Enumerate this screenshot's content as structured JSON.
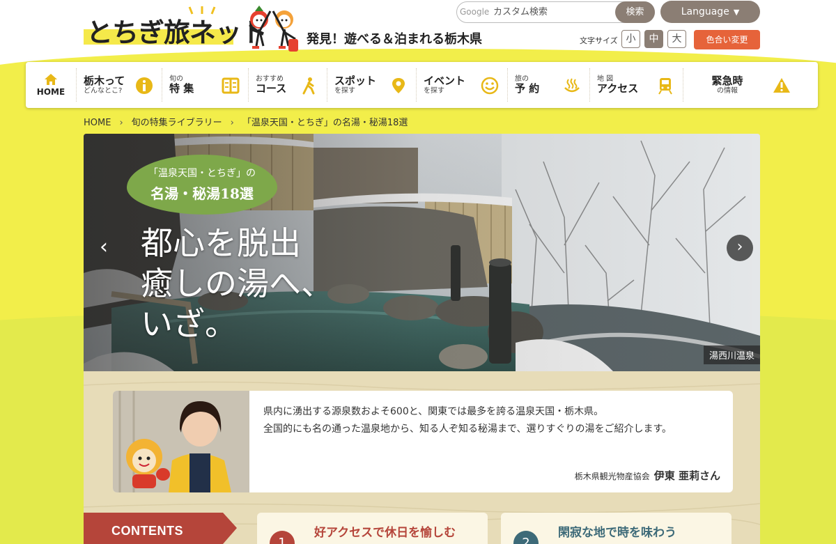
{
  "header": {
    "logo_text": "とちぎ旅ネット",
    "tagline": "発見！遊べる＆泊まれる栃木県",
    "search": {
      "brand": "Google",
      "placeholder": "カスタム検索",
      "button_label": "検索"
    },
    "language_label": "Language",
    "font_size": {
      "label": "文字サイズ",
      "small": "小",
      "medium": "中",
      "large": "大"
    },
    "color_button_label": "色合い変更"
  },
  "nav": {
    "home": "HOME",
    "items": [
      {
        "big": "栃木って",
        "small": "どんなとこ?",
        "icon": "info-icon"
      },
      {
        "small": "旬の",
        "big": "特 集",
        "icon": "book-icon"
      },
      {
        "small": "おすすめ",
        "big": "コース",
        "icon": "walking-icon"
      },
      {
        "big": "スポット",
        "small": "を探す",
        "icon": "pin-icon"
      },
      {
        "big": "イベント",
        "small": "を探す",
        "icon": "smile-icon"
      },
      {
        "small": "旅の",
        "big": "予 約",
        "icon": "onsen-icon"
      },
      {
        "small": "地 図",
        "big": "アクセス",
        "icon": "train-icon"
      },
      {
        "big": "緊急時",
        "small": "の情報",
        "icon": "warning-icon"
      }
    ]
  },
  "breadcrumb": {
    "home": "HOME",
    "library": "旬の特集ライブラリー",
    "current": "「温泉天国・とちぎ」の名湯・秘湯18選"
  },
  "hero": {
    "badge_line1": "「温泉天国・とちぎ」の",
    "badge_line2": "名湯・秘湯18選",
    "copy_line1": "都心を脱出",
    "copy_line2": "癒しの湯へ、",
    "copy_line3": "いざ。",
    "caption": "湯西川温泉",
    "prev": "‹",
    "next": "›"
  },
  "intro": {
    "line1": "県内に湧出する源泉数およそ600と、関東では最多を誇る温泉天国・栃木県。",
    "line2": "全国的にも名の通った温泉地から、知る人ぞ知る秘湯まで、選りすぐりの湯をご紹介します。",
    "org": "栃木県観光物産協会",
    "name": "伊東 亜莉さん"
  },
  "contents": {
    "label": "CONTENTS",
    "cards": [
      {
        "num": "1",
        "title": "好アクセスで休日を愉しむ"
      },
      {
        "num": "2",
        "title": "閑寂な地で時を味わう"
      }
    ]
  },
  "colors": {
    "brand_yellow": "#f2ee4a",
    "nav_icon_yellow": "#e8b817",
    "button_gray": "#8b7e74",
    "accent_orange": "#e6633a",
    "badge_green": "#7ea84a",
    "contents_red": "#b5453a"
  }
}
